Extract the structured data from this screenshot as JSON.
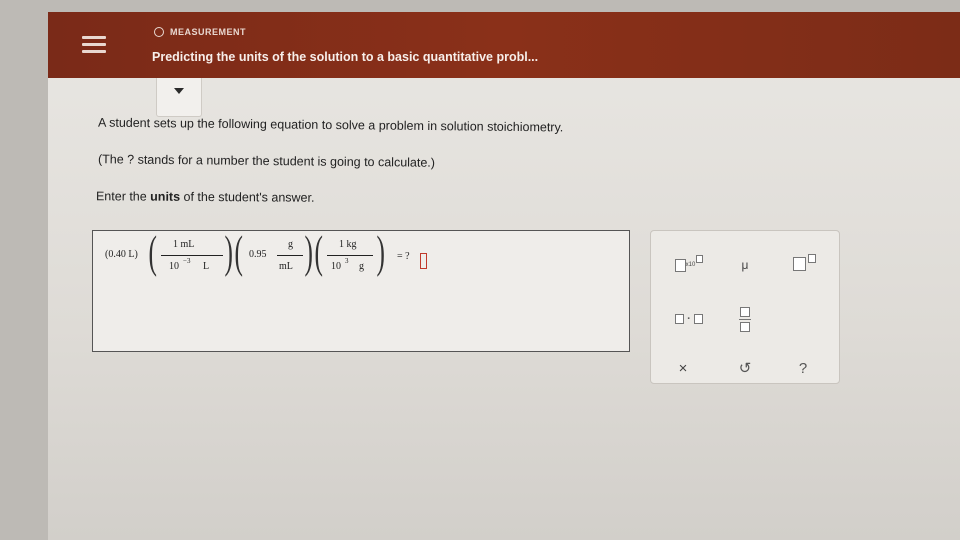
{
  "header": {
    "breadcrumb": "MEASUREMENT",
    "title": "Predicting the units of the solution to a basic quantitative probl..."
  },
  "problem": {
    "line1": "A student sets up the following equation to solve a problem in solution stoichiometry.",
    "line2": "(The ? stands for a number the student is going to calculate.)",
    "line3_prefix": "Enter the ",
    "line3_bold": "units",
    "line3_suffix": " of the student's answer."
  },
  "equation": {
    "term1": "(0.40 L)",
    "frac1_num": "1 mL",
    "frac1_den_base": "10",
    "frac1_den_exp": "−3",
    "frac1_den_unit": "L",
    "coef2": "0.95",
    "frac2_num": "g",
    "frac2_den": "mL",
    "frac3_num": "1 kg",
    "frac3_den_base": "10",
    "frac3_den_exp": "3",
    "frac3_den_unit": "g",
    "equals": "= ?"
  },
  "palette": {
    "sci_notation_label": "x10",
    "mu": "μ",
    "dot": "·",
    "clear": "×",
    "undo": "↺",
    "help": "?"
  },
  "colors": {
    "header_bg": "#7a2a18",
    "cursor": "#c0392b"
  }
}
